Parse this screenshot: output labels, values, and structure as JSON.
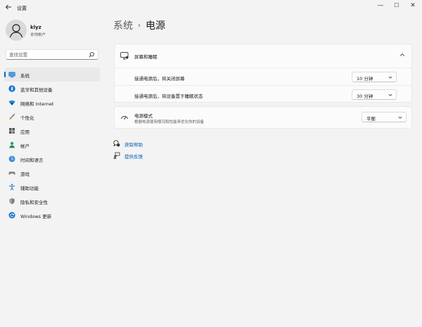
{
  "window": {
    "title": "设置",
    "controls": {
      "minimize": "—",
      "maximize": "☐",
      "close": "✕"
    }
  },
  "user": {
    "name": "klyz",
    "account_type": "本地帐户"
  },
  "search": {
    "placeholder": "查找设置"
  },
  "sidebar": {
    "items": [
      {
        "label": "系统",
        "icon": "monitor-icon",
        "active": true
      },
      {
        "label": "蓝牙和其他设备",
        "icon": "bluetooth-icon"
      },
      {
        "label": "网络和 Internet",
        "icon": "wifi-icon"
      },
      {
        "label": "个性化",
        "icon": "brush-icon"
      },
      {
        "label": "应用",
        "icon": "apps-icon"
      },
      {
        "label": "帐户",
        "icon": "person-icon"
      },
      {
        "label": "时间和语言",
        "icon": "globe-clock-icon"
      },
      {
        "label": "游戏",
        "icon": "gamepad-icon"
      },
      {
        "label": "辅助功能",
        "icon": "accessibility-icon"
      },
      {
        "label": "隐私和安全性",
        "icon": "shield-icon"
      },
      {
        "label": "Windows 更新",
        "icon": "update-icon"
      }
    ]
  },
  "breadcrumb": {
    "parent": "系统",
    "separator": "›",
    "current": "电源"
  },
  "screen_sleep": {
    "title": "屏幕和睡眠",
    "expanded": true,
    "rows": [
      {
        "label": "接通电源后，将关闭屏幕",
        "value": "10 分钟"
      },
      {
        "label": "接通电源后，将设备置于睡眠状态",
        "value": "30 分钟"
      }
    ]
  },
  "power_mode": {
    "title": "电源模式",
    "description": "根据电源使用情况和性能来优化你的设备",
    "value": "平衡"
  },
  "links": {
    "help": "获取帮助",
    "feedback": "提供反馈"
  },
  "colors": {
    "accent": "#0067c0",
    "link": "#0060b8",
    "background": "#f3f3f3",
    "card": "#fbfbfb"
  }
}
